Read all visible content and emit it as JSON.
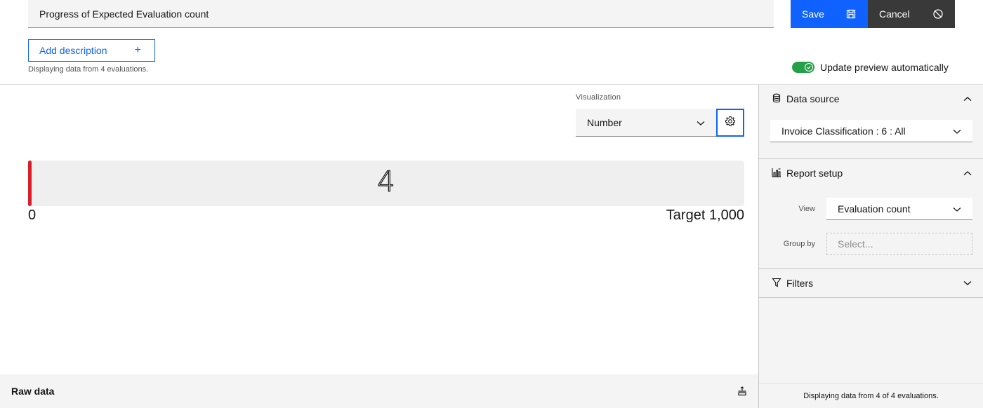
{
  "header": {
    "title_value": "Progress of Expected Evaluation count",
    "save_label": "Save",
    "save_icon": "save-icon",
    "cancel_label": "Cancel",
    "cancel_icon": "cancel-icon",
    "add_description_label": "Add description",
    "add_description_icon": "+",
    "helper_text": "Displaying data from 4 evaluations.",
    "auto_update_label": "Update preview automatically",
    "auto_update_on": true
  },
  "visualization": {
    "label": "Visualization",
    "selected": "Number",
    "settings_icon": "gear-icon"
  },
  "progress": {
    "value_text": "4",
    "value": 4,
    "min_text": "0",
    "min": 0,
    "target_text": "Target 1,000",
    "target": 1000,
    "fill_color": "#da1e28"
  },
  "raw_data": {
    "title": "Raw data",
    "icon": "expand-up-icon"
  },
  "sidebar": {
    "data_source": {
      "title": "Data source",
      "selected": "Invoice Classification : 6 : All",
      "expanded": true
    },
    "report_setup": {
      "title": "Report setup",
      "view_label": "View",
      "view_selected": "Evaluation count",
      "group_by_label": "Group by",
      "group_by_placeholder": "Select...",
      "expanded": true
    },
    "filters": {
      "title": "Filters",
      "expanded": false
    },
    "footer_text": "Displaying data from 4 of 4 evaluations."
  },
  "colors": {
    "primary": "#0f62fe",
    "secondary": "#393939",
    "toggle_on": "#24a148",
    "danger": "#da1e28"
  }
}
